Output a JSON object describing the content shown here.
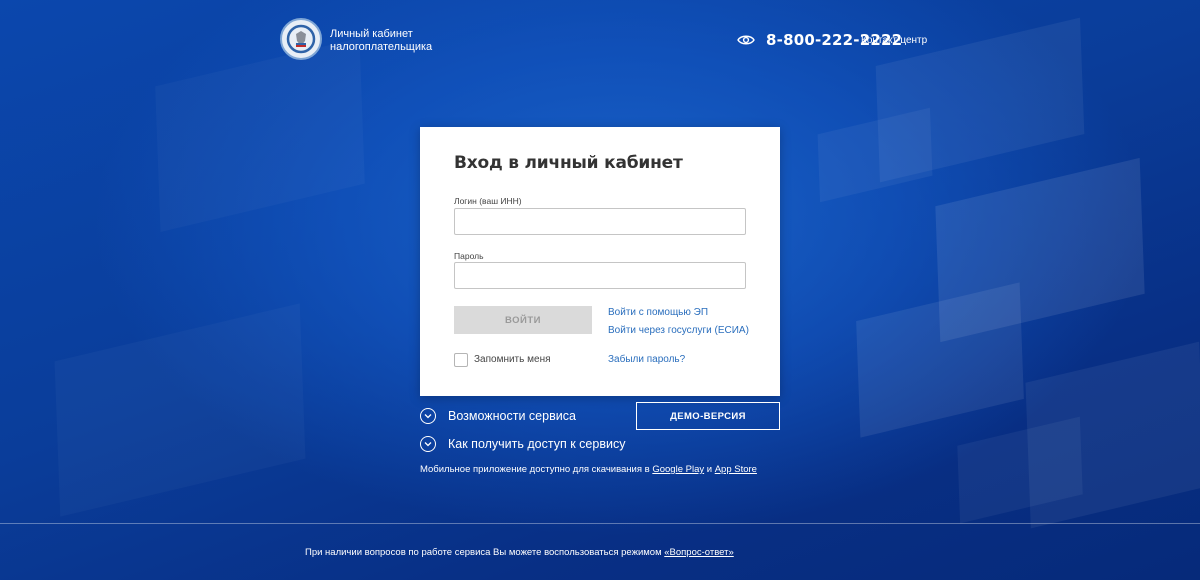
{
  "header": {
    "logo_title_line1": "Личный кабинет",
    "logo_title_line2": "налогоплательщика",
    "phone": "8-800-222-2222",
    "contact_label": "Контакт-центр"
  },
  "login_form": {
    "title": "Вход в личный кабинет",
    "login_label": "Логин (ваш ИНН)",
    "login_value": "",
    "password_label": "Пароль",
    "password_value": "",
    "submit_label": "ВОЙТИ",
    "link_ep": "Войти с помощью ЭП",
    "link_esia": "Войти через госуслуги (ЕСИА)",
    "remember_label": "Запомнить меня",
    "remember_checked": false,
    "forgot_link": "Забыли пароль?"
  },
  "below_card": {
    "features_label": "Возможности сервиса",
    "access_label": "Как получить доступ к сервису",
    "demo_label": "ДЕМО-ВЕРСИЯ",
    "mobile_text_before": "Мобильное приложение доступно для скачивания в",
    "google_play": "Google Play",
    "and_text": "и",
    "app_store": "App Store"
  },
  "footer": {
    "text_before": "При наличии вопросов по работе сервиса Вы можете воспользоваться режимом",
    "qa_link": "«Вопрос-ответ»"
  },
  "colors": {
    "background": "#0a3d9c",
    "link": "#2a6ebd",
    "button_disabled": "#dadada"
  },
  "icons": [
    "emblem-logo",
    "eye-icon",
    "chevron-down-icon"
  ]
}
